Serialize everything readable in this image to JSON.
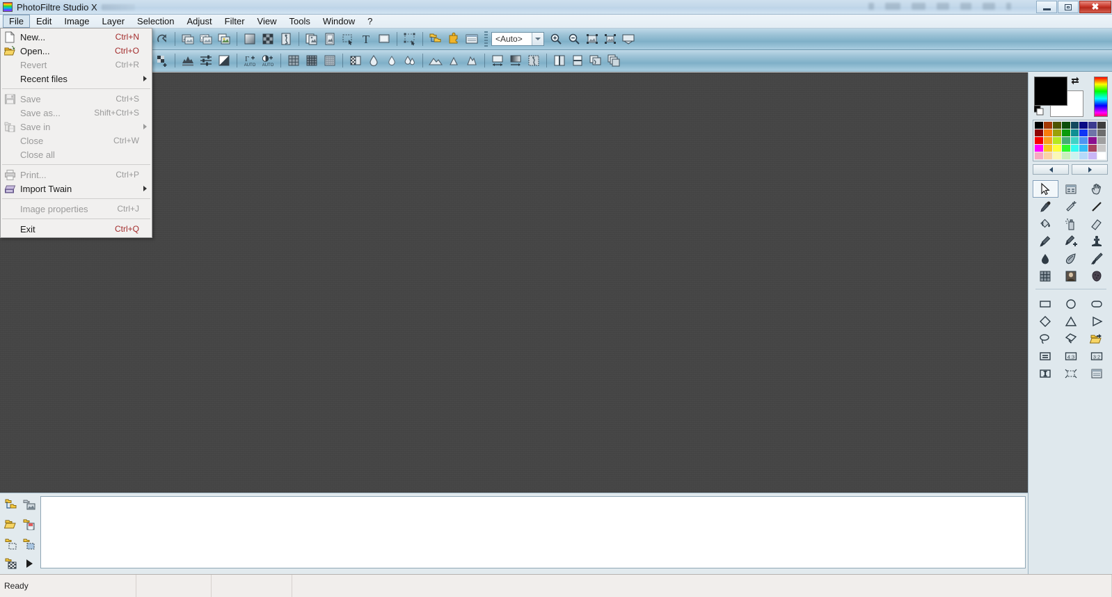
{
  "window": {
    "title": "PhotoFiltre Studio X",
    "logo_icon": "photofiltre-logo-icon",
    "minimize_label": "Minimize",
    "restore_label": "Restore",
    "close_label": "Close",
    "close_glyph": "✖"
  },
  "menubar": {
    "items": [
      {
        "label": "File",
        "active": true
      },
      {
        "label": "Edit",
        "active": false
      },
      {
        "label": "Image",
        "active": false
      },
      {
        "label": "Layer",
        "active": false
      },
      {
        "label": "Selection",
        "active": false
      },
      {
        "label": "Adjust",
        "active": false
      },
      {
        "label": "Filter",
        "active": false
      },
      {
        "label": "View",
        "active": false
      },
      {
        "label": "Tools",
        "active": false
      },
      {
        "label": "Window",
        "active": false
      },
      {
        "label": "?",
        "active": false
      }
    ]
  },
  "file_menu": {
    "open": true,
    "items": [
      {
        "label": "New...",
        "accel": "Ctrl+N",
        "disabled": false,
        "icon": "new-document-icon",
        "submenu": false
      },
      {
        "label": "Open...",
        "accel": "Ctrl+O",
        "disabled": false,
        "icon": "open-folder-icon",
        "submenu": false
      },
      {
        "label": "Revert",
        "accel": "Ctrl+R",
        "disabled": true,
        "icon": "",
        "submenu": false
      },
      {
        "label": "Recent files",
        "accel": "",
        "disabled": false,
        "icon": "",
        "submenu": true
      },
      {
        "separator": true
      },
      {
        "label": "Save",
        "accel": "Ctrl+S",
        "disabled": true,
        "icon": "floppy-save-icon",
        "submenu": false
      },
      {
        "label": "Save as...",
        "accel": "Shift+Ctrl+S",
        "disabled": true,
        "icon": "",
        "submenu": false
      },
      {
        "label": "Save in",
        "accel": "",
        "disabled": true,
        "icon": "save-in-icon",
        "submenu": true
      },
      {
        "label": "Close",
        "accel": "Ctrl+W",
        "disabled": true,
        "icon": "",
        "submenu": false
      },
      {
        "label": "Close all",
        "accel": "",
        "disabled": true,
        "icon": "",
        "submenu": false
      },
      {
        "separator": true
      },
      {
        "label": "Print...",
        "accel": "Ctrl+P",
        "disabled": true,
        "icon": "printer-icon",
        "submenu": false
      },
      {
        "label": "Import Twain",
        "accel": "",
        "disabled": false,
        "icon": "scanner-icon",
        "submenu": true
      },
      {
        "separator": true
      },
      {
        "label": "Image properties",
        "accel": "Ctrl+J",
        "disabled": true,
        "icon": "",
        "submenu": false
      },
      {
        "separator": true
      },
      {
        "label": "Exit",
        "accel": "Ctrl+Q",
        "disabled": false,
        "icon": "",
        "submenu": false
      }
    ]
  },
  "toolbar_row1": {
    "icons": [
      "redo-arrow-icon",
      "sep",
      "image-duplicate-icon",
      "image-transparency-icon",
      "image-export-icon",
      "sep",
      "gradient-square-icon",
      "checkerboard-icon",
      "image-effect-icon",
      "sep",
      "image-copy-icon",
      "image-frame-icon",
      "selection-marquee-icon",
      "text-tool-icon",
      "image-paste-icon",
      "sep",
      "transform-nodes-icon",
      "sep",
      "folder-tree-icon",
      "puzzle-plugin-icon",
      "properties-panel-icon"
    ],
    "zoom_combo": {
      "value": "<Auto>",
      "arrow_icon": "chevron-down-icon"
    },
    "zoom_icons": [
      "zoom-in-icon",
      "zoom-out-icon",
      "fit-to-window-icon",
      "actual-size-icon",
      "fullscreen-icon"
    ]
  },
  "toolbar_row2": {
    "icons": [
      "add-layer-icon",
      "sep",
      "histogram-icon",
      "levels-sliders-icon",
      "contrast-icon",
      "sep",
      "auto-gamma-icon",
      "auto-contrast-icon",
      "sep",
      "grid-coarse-icon",
      "grid-medium-icon",
      "grid-fine-icon",
      "sep",
      "halftone-icon",
      "drop-single-icon",
      "drop-small-icon",
      "drop-double-icon",
      "sep",
      "mountain-wide-icon",
      "mountain-narrow-icon",
      "mountain-tall-icon",
      "sep",
      "resize-width-icon",
      "gradient-bar-icon",
      "texture-icon",
      "sep",
      "book-pages-icon",
      "page-split-icon",
      "image-merge-icon",
      "image-stack-icon"
    ]
  },
  "bottom_dock": {
    "icons": [
      "folder-tree-open-icon",
      "folder-image-icon",
      "folder-open-icon",
      "folder-save-icon",
      "folder-selection-icon",
      "folder-mask-icon",
      "folder-transparent-icon",
      "play-arrow-icon"
    ],
    "panel_content": ""
  },
  "right_panel": {
    "colors": {
      "foreground": "#000000",
      "background": "#ffffff",
      "swap_icon": "swap-colors-icon",
      "default_icon": "default-colors-icon",
      "hue_strip_icon": "hue-spectrum-icon"
    },
    "palette": [
      "#000000",
      "#a33803",
      "#4e5400",
      "#0b4e09",
      "#14495e",
      "#0b0b85",
      "#3b3b8f",
      "#3d3d3d",
      "#8e0404",
      "#f97c0a",
      "#9aa008",
      "#0a9a0c",
      "#0e8f93",
      "#1036f5",
      "#6f74a8",
      "#6e6e6e",
      "#f70000",
      "#fba01b",
      "#b6e820",
      "#44ac73",
      "#3fd3c6",
      "#4f95f2",
      "#8b0f8f",
      "#a0a0a0",
      "#ff00ff",
      "#ffc61e",
      "#ffff3b",
      "#2dfb2d",
      "#35fbf0",
      "#35bdf7",
      "#a8425f",
      "#c8c8c8",
      "#f9a8c0",
      "#fbd2a5",
      "#fbf7b6",
      "#c9f0bb",
      "#cdf3ef",
      "#b6d9f9",
      "#c9b6f7",
      "#ffffff"
    ],
    "palette_nav": {
      "prev_icon": "palette-prev-icon",
      "next_icon": "palette-next-icon"
    },
    "tools_group_a": [
      {
        "icon": "pointer-select-icon",
        "selected": true
      },
      {
        "icon": "screenshot-icon",
        "selected": false
      },
      {
        "icon": "hand-pan-icon",
        "selected": false
      },
      {
        "icon": "eyedropper-icon",
        "selected": false
      },
      {
        "icon": "magic-wand-icon",
        "selected": false
      },
      {
        "icon": "line-tool-icon",
        "selected": false
      },
      {
        "icon": "paint-bucket-icon",
        "selected": false
      },
      {
        "icon": "spray-can-icon",
        "selected": false
      },
      {
        "icon": "eraser-icon",
        "selected": false
      },
      {
        "icon": "paintbrush-icon",
        "selected": false
      },
      {
        "icon": "advanced-brush-icon",
        "selected": false
      },
      {
        "icon": "stamp-clone-icon",
        "selected": false
      },
      {
        "icon": "blur-drop-icon",
        "selected": false
      },
      {
        "icon": "smudge-finger-icon",
        "selected": false
      },
      {
        "icon": "broom-clean-icon",
        "selected": false
      },
      {
        "icon": "grid-overlay-icon",
        "selected": false
      },
      {
        "icon": "portrait-photo-icon",
        "selected": false
      },
      {
        "icon": "sponge-icon",
        "selected": false
      }
    ],
    "tools_group_b": [
      {
        "icon": "rectangle-shape-icon",
        "selected": false
      },
      {
        "icon": "circle-shape-icon",
        "selected": false
      },
      {
        "icon": "rounded-rect-shape-icon",
        "selected": false
      },
      {
        "icon": "diamond-shape-icon",
        "selected": false
      },
      {
        "icon": "triangle-shape-icon",
        "selected": false
      },
      {
        "icon": "triangle-right-icon",
        "selected": false
      },
      {
        "icon": "lasso-shape-icon",
        "selected": false
      },
      {
        "icon": "polygon-shape-icon",
        "selected": false
      },
      {
        "icon": "load-selection-icon",
        "selected": false
      },
      {
        "icon": "fixed-size-icon",
        "selected": false
      },
      {
        "icon": "ratio-4-3-icon",
        "selected": false
      },
      {
        "icon": "ratio-3-2-icon",
        "selected": false
      },
      {
        "icon": "vertical-bar-icon",
        "selected": false
      },
      {
        "icon": "expand-selection-icon",
        "selected": false
      },
      {
        "icon": "selection-options-icon",
        "selected": false
      }
    ],
    "ratio_labels": {
      "r43": "4:3",
      "r32": "3:2"
    }
  },
  "statusbar": {
    "cells": [
      "Ready",
      "",
      "",
      "",
      ""
    ]
  }
}
